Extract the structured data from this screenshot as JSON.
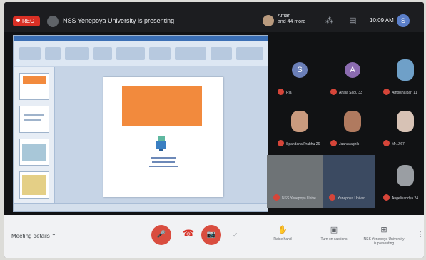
{
  "topbar": {
    "rec_label": "REC",
    "presenting_text": "NSS Yenepoya University is presenting",
    "attendee_name": "Aman",
    "attendee_more": "and 44 more",
    "clock": "10:09 AM",
    "self_initial": "S"
  },
  "participants": [
    {
      "initial": "S",
      "name": "Ria",
      "color": "#6b7fb8"
    },
    {
      "initial": "A",
      "name": "Anaja Sadu 33",
      "color": "#8b6bb0"
    },
    {
      "initial": "",
      "name": "Amolshalbarj 11",
      "color": "#6fa0c8"
    },
    {
      "initial": "",
      "name": "Spandana Prabhu 26",
      "color": "#c99a7e"
    },
    {
      "initial": "",
      "name": "Jaanavaghik",
      "color": "#b07a5f"
    },
    {
      "initial": "",
      "name": "Mr. J 67",
      "color": "#d7c2b5"
    },
    {
      "initial": "",
      "name": "NSS Yenepoya Unive...",
      "color": "#6e7376"
    },
    {
      "initial": "",
      "name": "Yenepoya Univer...",
      "color": "#3b4a61"
    },
    {
      "initial": "",
      "name": "Angelikandya 24",
      "color": "#9a9ea3"
    }
  ],
  "controls": {
    "meeting_details": "Meeting details",
    "mic_glyph": "🎤",
    "cam_glyph": "📷",
    "raise_hand": "Raise hand",
    "captions": "Turn on captions",
    "present_now": "NSS Yenepoya University is presenting"
  },
  "colors": {
    "accent_red": "#d93025",
    "topbar": "#1c1d20",
    "slide_banner": "#f28a3d"
  }
}
